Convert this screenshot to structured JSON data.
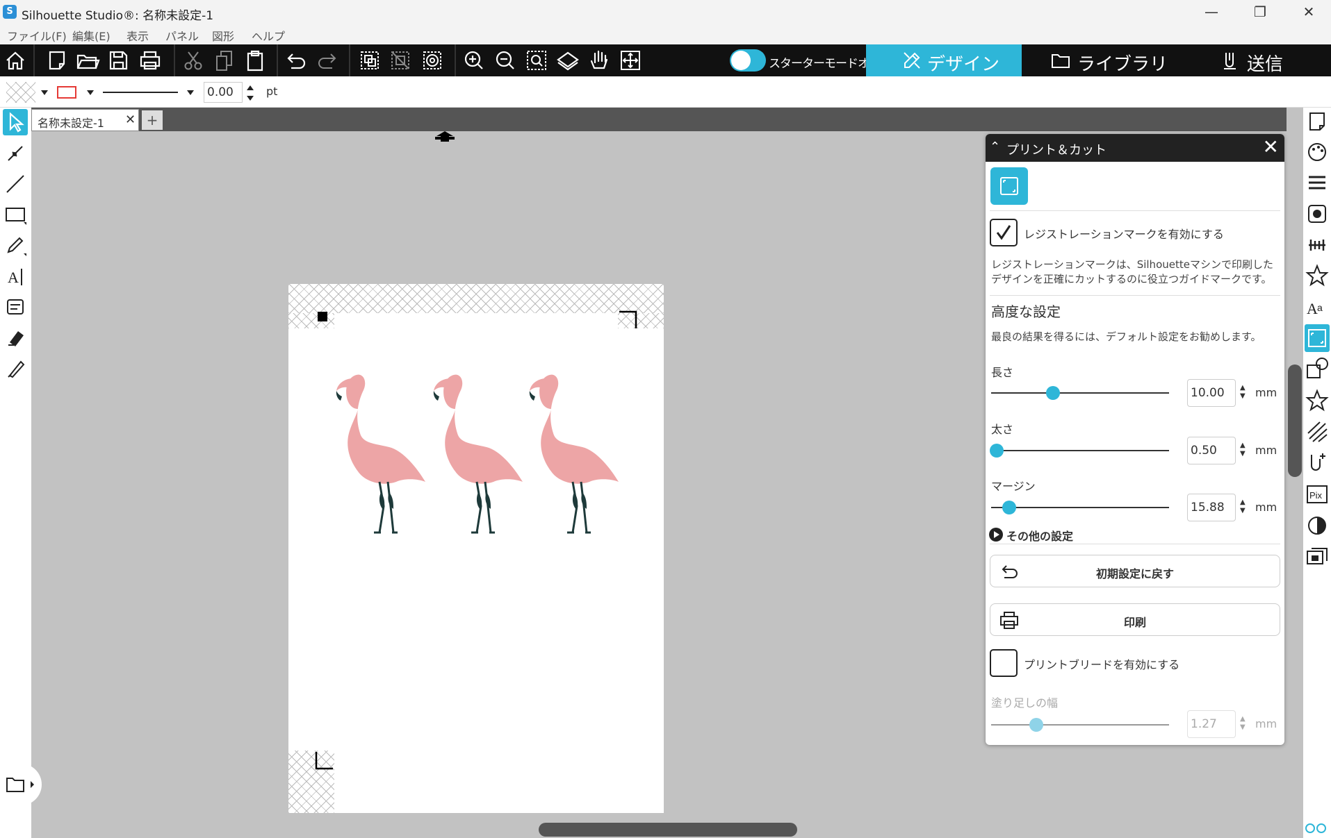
{
  "window": {
    "title": "Silhouette Studio®: 名称未設定-1",
    "minimize_glyph": "—",
    "restore_glyph": "❐",
    "close_glyph": "✕"
  },
  "menubar": {
    "items": [
      "ファイル(F)",
      "編集(E)",
      "表示",
      "パネル",
      "図形",
      "ヘルプ"
    ]
  },
  "toolbar": {
    "starter_mode_label": "スターターモードオフ",
    "tabs": {
      "design": "デザイン",
      "library": "ライブラリ",
      "send": "送信"
    },
    "icons": [
      "home-icon",
      "new-document-icon",
      "open-folder-icon",
      "save-icon",
      "print-icon",
      "cut-icon",
      "copy-icon",
      "paste-icon",
      "undo-icon",
      "redo-icon",
      "group-icon",
      "ungroup-icon",
      "compound-path-icon",
      "zoom-in-icon",
      "zoom-out-icon",
      "zoom-selection-icon",
      "pan-drag-icon",
      "hand-icon",
      "fit-to-page-icon"
    ]
  },
  "propbar": {
    "line_width_value": "0.00",
    "line_width_unit": "pt",
    "line_color": "#e53935"
  },
  "document": {
    "tab_label": "名称未設定-1",
    "tab_close": "✕",
    "add_tab": "+"
  },
  "print_cut_panel": {
    "title": "プリント＆カット",
    "enable_reg_marks_label": "レジストレーションマークを有効にする",
    "enable_reg_marks_checked": true,
    "description": "レジストレーションマークは、Silhouetteマシンで印刷したデザインを正確にカットするのに役立つガイドマークです。",
    "advanced_heading": "高度な設定",
    "advanced_note": "最良の結果を得るには、デフォルト設定をお勧めします。",
    "settings": [
      {
        "label": "長さ",
        "value": "10.00",
        "unit": "mm",
        "slider_fraction": 0.34
      },
      {
        "label": "太さ",
        "value": "0.50",
        "unit": "mm",
        "slider_fraction": 0.04
      },
      {
        "label": "マージン",
        "value": "15.88",
        "unit": "mm",
        "slider_fraction": 0.11
      }
    ],
    "more_settings_label": "その他の設定",
    "reset_button_label": "初期設定に戻す",
    "print_button_label": "印刷",
    "enable_bleed_label": "プリントブリードを有効にする",
    "enable_bleed_checked": false,
    "bleed_width_label": "塗り足しの幅",
    "bleed_width_value": "1.27",
    "bleed_width_unit": "mm",
    "bleed_slider_fraction": 0.26
  },
  "colors": {
    "accent": "#2eb6d8",
    "toolbar_bg": "#111111",
    "canvas_bg": "#c2c2c2",
    "flamingo_pink": "#eda5a6",
    "flamingo_legs": "#1e3a3a"
  }
}
